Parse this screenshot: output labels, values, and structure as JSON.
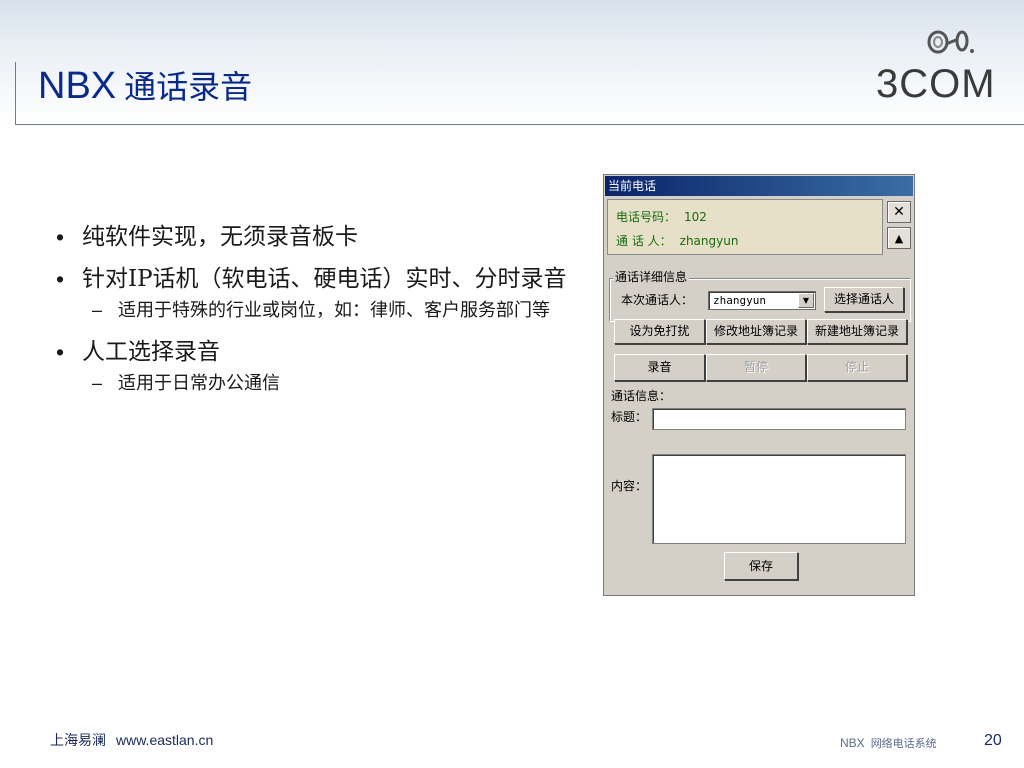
{
  "slide": {
    "title_en": "NBX",
    "title_zh": "通话录音",
    "logo_text": "3COM"
  },
  "bullets": [
    {
      "text": "纯软件实现，无须录音板卡",
      "children": []
    },
    {
      "text": "针对IP话机（软电话、硬电话）实时、分时录音",
      "children": [
        "适用于特殊的行业或岗位，如：律师、客户服务部门等"
      ]
    },
    {
      "text": "人工选择录音",
      "children": [
        "适用于日常办公通信"
      ]
    }
  ],
  "bullet_mark": "•",
  "sub_mark": "–",
  "window": {
    "title": "当前电话",
    "phone_label": "电话号码：",
    "phone_value": "102",
    "caller_label": "通 话 人：",
    "caller_value": "zhangyun",
    "close_glyph": "✕",
    "scroll_glyph": "▲",
    "group_label": "通话详细信息",
    "current_caller_label": "本次通话人：",
    "combo_value": "zhangyun",
    "combo_arrow": "▼",
    "select_caller_button": "选择通话人",
    "dnd_button": "设为免打扰",
    "edit_addressbook_button": "修改地址簿记录",
    "new_addressbook_button": "新建地址簿记录",
    "record_button": "录音",
    "pause_button": "暂停",
    "stop_button": "停止",
    "call_info_label": "通话信息：",
    "subject_label": "标题：",
    "content_label": "内容：",
    "save_button": "保存"
  },
  "footer": {
    "company": "上海易澜",
    "url": "www.eastlan.cn",
    "product_en": "NBX",
    "product_zh": "网络电话系统",
    "page": "20"
  },
  "colors": {
    "title": "#0a2a8a",
    "titlebar": "#0a246a",
    "info_panel": "#e6e0c8",
    "info_text": "#1a6a10",
    "window_bg": "#d4d0c8"
  }
}
